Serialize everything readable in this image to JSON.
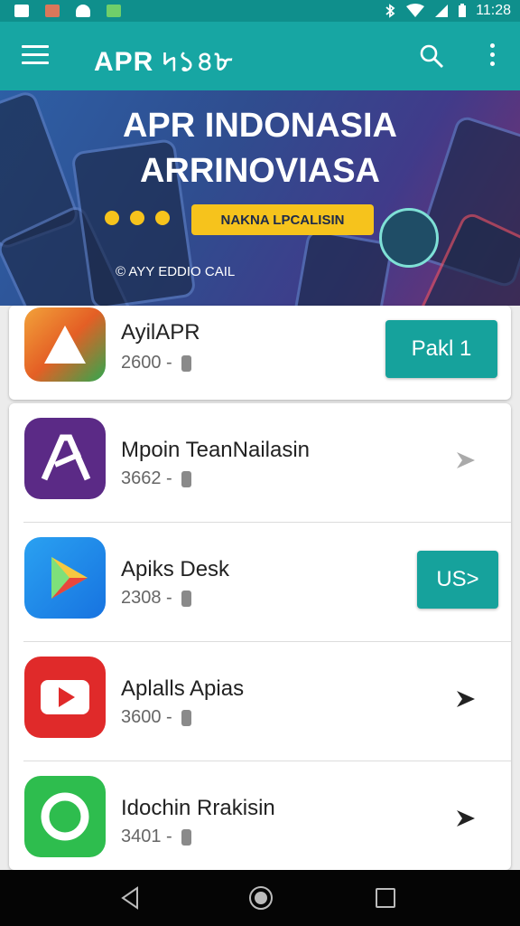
{
  "status_bar": {
    "time": "11:28"
  },
  "app_bar": {
    "title": "APR ৸১৪৮"
  },
  "banner": {
    "title_line1": "APR INDONASIA",
    "title_line2": "ARRINOVIASA",
    "pill_text": "NAKNA LPCALISIN",
    "caption": "© AYY EDDIO CAIL"
  },
  "apps": [
    {
      "name": "AyilAPR",
      "meta": "2600 -",
      "action": "Pakl 1",
      "action_type": "button"
    },
    {
      "name": "Mpoin TeanNailasin",
      "meta": "3662 -",
      "action_type": "arrow"
    },
    {
      "name": "Apiks Desk",
      "meta": "2308 -",
      "action": "US>",
      "action_type": "button"
    },
    {
      "name": "Aplalls Apias",
      "meta": "3600 -",
      "action_type": "arrow"
    },
    {
      "name": "Idochin Rrakisin",
      "meta": "3401 -",
      "action_type": "arrow"
    }
  ],
  "colors": {
    "accent": "#17a6a3",
    "button": "#16a29c",
    "status_bar": "#0f8f8c"
  },
  "icons": [
    "menu-icon",
    "search-icon",
    "more-vert-icon",
    "forward-arrow-icon",
    "back-icon",
    "home-icon",
    "recents-icon"
  ]
}
